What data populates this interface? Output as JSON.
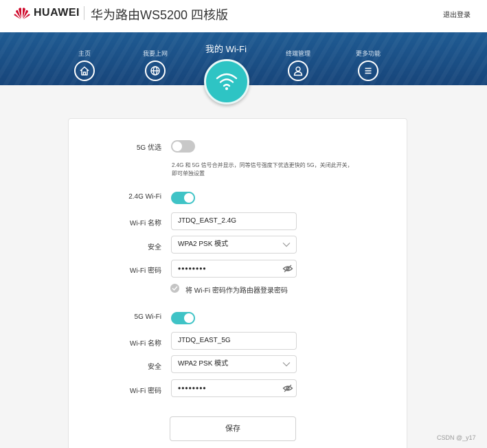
{
  "header": {
    "brand": "HUAWEI",
    "model": "华为路由WS5200 四核版",
    "logout": "退出登录",
    "colors": {
      "logo_red": "#cf0a2c"
    }
  },
  "nav": {
    "items": [
      {
        "label": "主页",
        "icon": "home-icon"
      },
      {
        "label": "我要上网",
        "icon": "globe-icon"
      },
      {
        "label": "终端管理",
        "icon": "user-icon"
      },
      {
        "label": "更多功能",
        "icon": "menu-icon"
      }
    ],
    "active": {
      "label": "我的 Wi-Fi",
      "icon": "wifi-icon"
    },
    "colors": {
      "bar": "#1c5088",
      "active": "#2ec4c4"
    }
  },
  "form": {
    "prefer5g": {
      "label": "5G 优选",
      "enabled": false,
      "note": "2.4G 和 5G 信号合并显示，同等信号强度下优选更快的 5G，关闭此开关，即可单独设置"
    },
    "wifi24": {
      "label": "2.4G Wi-Fi",
      "enabled": true,
      "name_label": "Wi-Fi 名称",
      "name_value": "JTDQ_EAST_2.4G",
      "security_label": "安全",
      "security_value": "WPA2 PSK 模式",
      "password_label": "Wi-Fi 密码",
      "password_value": "••••••••"
    },
    "use_as_login": {
      "label": "将 Wi-Fi 密码作为路由器登录密码",
      "checked": false
    },
    "wifi5": {
      "label": "5G Wi-Fi",
      "enabled": true,
      "name_label": "Wi-Fi 名称",
      "name_value": "JTDQ_EAST_5G",
      "security_label": "安全",
      "security_value": "WPA2 PSK 模式",
      "password_label": "Wi-Fi 密码",
      "password_value": "••••••••"
    },
    "save_label": "保存",
    "colors": {
      "toggle_on": "#3fc3c6",
      "toggle_off": "#c8c8c8"
    }
  },
  "watermark": "CSDN @_y17"
}
